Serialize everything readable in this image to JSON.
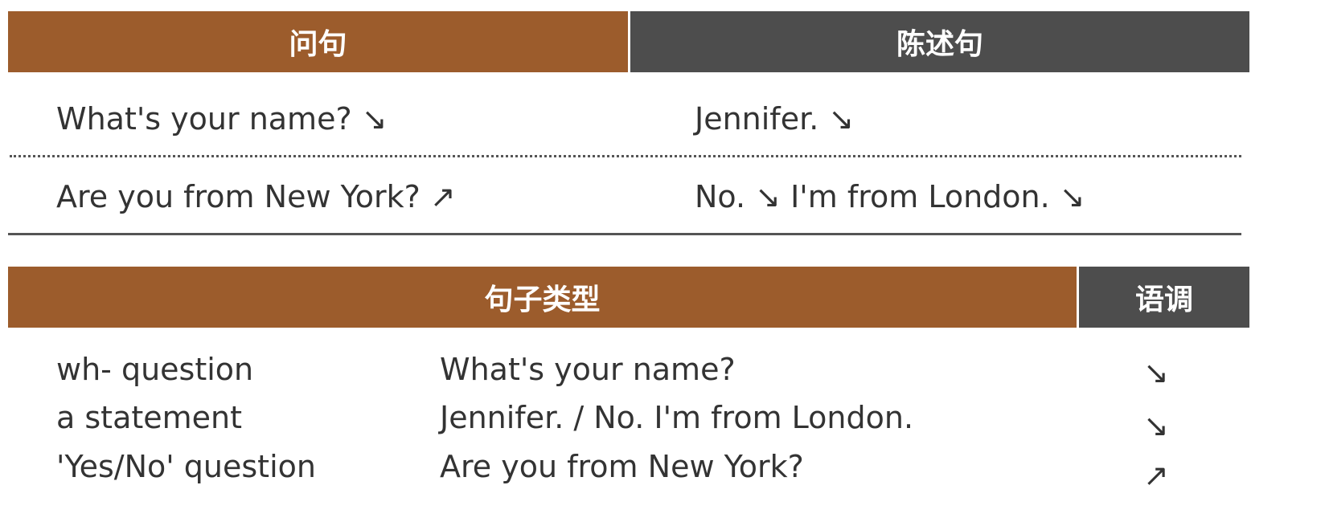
{
  "colors": {
    "brown": "#9c5c2c",
    "gray": "#4d4d4d",
    "text": "#333333"
  },
  "table1": {
    "header_question": "问句",
    "header_statement": "陈述句",
    "rows": [
      {
        "question": "What's your name? ↘",
        "statement": "Jennifer. ↘"
      },
      {
        "question": "Are you from New York? ↗",
        "statement": "No. ↘ I'm from London. ↘"
      }
    ]
  },
  "table2": {
    "header_type": "句子类型",
    "header_intonation": "语调",
    "rows": [
      {
        "type": "wh- question",
        "example": "What's your name?",
        "intonation": "↘"
      },
      {
        "type": "a statement",
        "example": "Jennifer. / No. I'm from London.",
        "intonation": "↘"
      },
      {
        "type": "'Yes/No' question",
        "example": "Are you from New York?",
        "intonation": "↗"
      }
    ]
  }
}
